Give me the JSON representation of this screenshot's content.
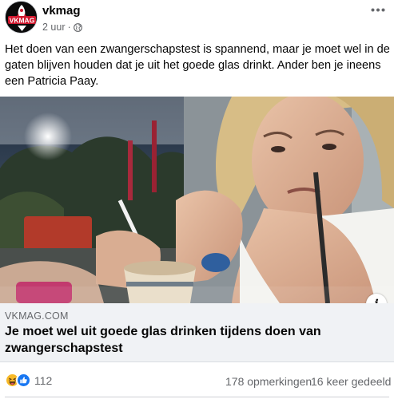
{
  "post": {
    "page_name": "vkmag",
    "avatar_logo_text": "VKMAG",
    "time": "2 uur",
    "audience_icon": "globe-icon",
    "more_icon": "more-horizontal-icon",
    "text": "Het doen van een zwangerschapstest is spannend, maar je moet wel in de gaten blijven houden dat je uit het goede glas drinkt. Ander ben je ineens een Patricia Paay."
  },
  "link_preview": {
    "info_icon_label": "i",
    "domain": "VKMAG.COM",
    "title": "Je moet wel uit goede glas drinken tijdens doen van zwangerschapstest"
  },
  "stats": {
    "reaction_icons": [
      "haha-icon",
      "like-icon"
    ],
    "reaction_count": "112",
    "comments": "178 opmerkingen",
    "shares": "16 keer gedeeld"
  },
  "colors": {
    "like_blue": "#1877f2",
    "haha_yellow": "#f7b928",
    "secondary_text": "#65676b",
    "link_bg": "#f0f2f5"
  }
}
